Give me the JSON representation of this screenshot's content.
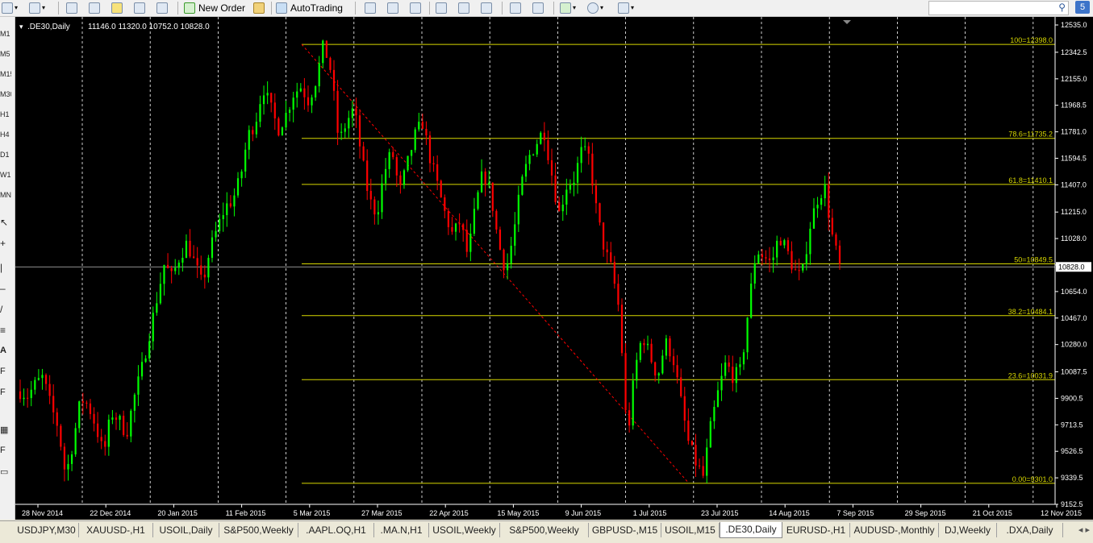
{
  "toolbar": {
    "new_order_label": "New Order",
    "autotrading_label": "AutoTrading"
  },
  "left_toolbar": {
    "timeframes": [
      "M1",
      "M5",
      "M15",
      "M30",
      "H1",
      "H4",
      "D1",
      "W1",
      "MN"
    ]
  },
  "chart_header": {
    "symbol": ".DE30,Daily",
    "ohlc": "11146.0 11320.0 10752.0 10828.0"
  },
  "chart_data": {
    "type": "candlestick",
    "background": "#000000",
    "bull_color": "#00ff00",
    "bear_color": "#ff0000",
    "grid": true,
    "ylim": [
      9152.5,
      12535.0
    ],
    "y_ticks": [
      "12535.0",
      "12342.5",
      "12155.0",
      "11968.5",
      "11781.0",
      "11594.5",
      "11407.0",
      "11215.0",
      "11028.0",
      "10841.5",
      "10654.0",
      "10467.0",
      "10280.0",
      "10087.5",
      "9900.5",
      "9713.5",
      "9526.5",
      "9339.5",
      "9152.5"
    ],
    "x_labels": [
      "28 Nov 2014",
      "22 Dec 2014",
      "20 Jan 2015",
      "11 Feb 2015",
      "5 Mar 2015",
      "27 Mar 2015",
      "22 Apr 2015",
      "15 May 2015",
      "9 Jun 2015",
      "1 Jul 2015",
      "23 Jul 2015",
      "14 Aug 2015",
      "7 Sep 2015",
      "29 Sep 2015",
      "21 Oct 2015",
      "12 Nov 2015"
    ],
    "current_price": 10828.0,
    "current_price_label": "10828.0",
    "fibonacci": {
      "high": 12398.0,
      "low": 9301.0,
      "levels": [
        {
          "label": "100=12398.0",
          "value": 12398.0
        },
        {
          "label": "78.6=11735.2",
          "value": 11735.2
        },
        {
          "label": "61.8=11410.1",
          "value": 11410.1
        },
        {
          "label": "50=10849.5",
          "value": 10849.5
        },
        {
          "label": "38.2=10484.1",
          "value": 10484.1
        },
        {
          "label": "23.6=10031.9",
          "value": 10031.9
        },
        {
          "label": "0.00=9301.0",
          "value": 9301.0
        }
      ]
    },
    "price_path": [
      9950,
      9920,
      10000,
      10050,
      9850,
      9700,
      9350,
      9600,
      9900,
      9850,
      9700,
      9500,
      9800,
      9750,
      9650,
      9900,
      10100,
      10350,
      10600,
      10850,
      10750,
      10900,
      11000,
      10850,
      10700,
      10950,
      11100,
      11250,
      11300,
      11450,
      11750,
      11850,
      12100,
      11950,
      11800,
      11900,
      12050,
      12100,
      12000,
      12150,
      12398,
      12200,
      11700,
      11850,
      11950,
      11600,
      11300,
      11200,
      11500,
      11650,
      11350,
      11550,
      11750,
      11850,
      11600,
      11400,
      11200,
      11050,
      11150,
      10900,
      11250,
      11500,
      11350,
      11000,
      10800,
      11050,
      11400,
      11600,
      11700,
      11800,
      11500,
      11200,
      11400,
      11450,
      11650,
      11600,
      11200,
      10950,
      10800,
      10500,
      9600,
      10100,
      10350,
      10200,
      10050,
      10300,
      10200,
      9900,
      9600,
      9450,
      9350,
      9700,
      9950,
      10150,
      10050,
      10100,
      10550,
      10950,
      10900,
      10850,
      11050,
      10950,
      10800,
      10750,
      11100,
      11300,
      11400,
      11050,
      10828
    ]
  },
  "tabs": [
    "USDJPY,M30",
    "XAUUSD-,H1",
    "USOIL,Daily",
    "S&P500,Weekly",
    ".AAPL.OQ,H1",
    ".MA.N,H1",
    "USOIL,Weekly",
    "S&P500,Weekly",
    "GBPUSD-,M15",
    "USOIL,M15",
    ".DE30,Daily",
    "EURUSD-,H1",
    "AUDUSD-,Monthly",
    "DJ,Weekly",
    ".DXA,Daily"
  ],
  "active_tab_index": 10,
  "badge_count": "5",
  "colors": {
    "fib_line": "#d8d800",
    "grid": "#ffffff",
    "axis_text": "#ffffff",
    "trend_line": "#ff0000"
  }
}
